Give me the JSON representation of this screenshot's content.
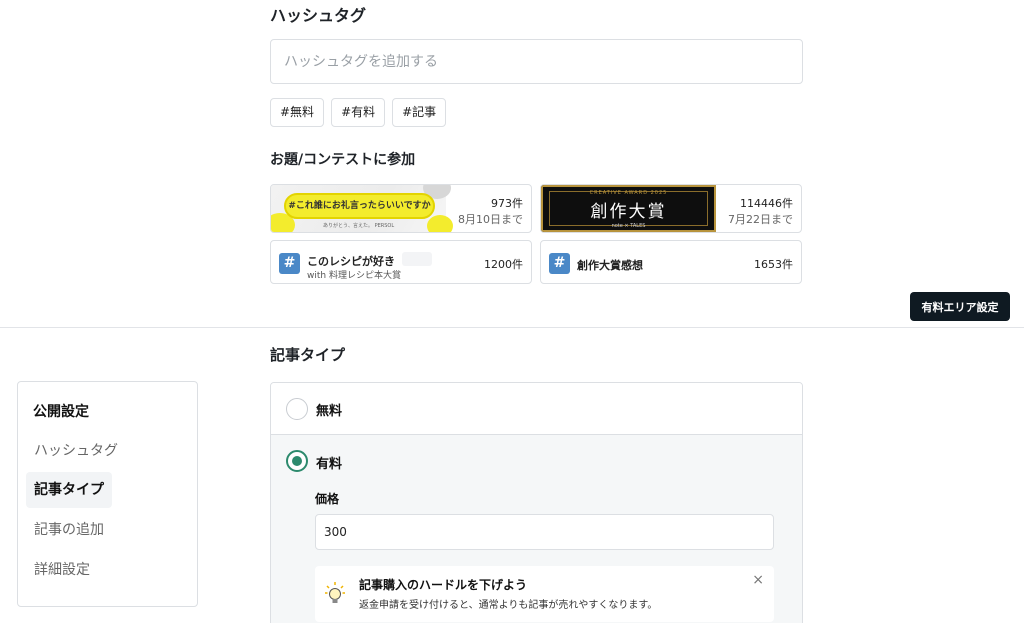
{
  "hashtag": {
    "title": "ハッシュタグ",
    "placeholder": "ハッシュタグを追加する",
    "tags": [
      "#無料",
      "#有料",
      "#記事"
    ]
  },
  "contest": {
    "title": "お題/コンテストに参加",
    "cards": [
      {
        "banner_text": "#これ誰にお礼言ったらいいですか",
        "banner_footnote": "ありがとう、言えた。 PERSOL",
        "count": "973件",
        "date": "8月10日まで"
      },
      {
        "banner_text": "創作大賞",
        "banner_small_top": "CREATIVE AWARD 2025",
        "banner_small_bottom": "note × TALES",
        "count": "114446件",
        "date": "7月22日まで"
      },
      {
        "icon": "#",
        "name": "このレシピが好き",
        "with": "with 料理レシピ本大賞",
        "count": "1200件"
      },
      {
        "icon": "#",
        "name": "創作大賞感想",
        "count": "1653件"
      }
    ]
  },
  "paid_area_button": "有料エリア設定",
  "settings_nav": {
    "heading": "公開設定",
    "items": [
      {
        "label": "ハッシュタグ",
        "active": false
      },
      {
        "label": "記事タイプ",
        "active": true
      },
      {
        "label": "記事の追加",
        "active": false
      },
      {
        "label": "詳細設定",
        "active": false
      }
    ]
  },
  "article_type": {
    "title": "記事タイプ",
    "free_label": "無料",
    "paid_label": "有料",
    "selected": "paid",
    "price_label": "価格",
    "price_value": "300",
    "tip_title": "記事購入のハードルを下げよう",
    "tip_body": "返金申請を受け付けると、通常よりも記事が売れやすくなります。",
    "tip_close": "×"
  },
  "colors": {
    "accent_green": "#2c8a6d",
    "dark_button": "#0f1a22",
    "hashtag_badge": "#4a88c7",
    "contest_banner_yellow": "#f3ec2d"
  }
}
